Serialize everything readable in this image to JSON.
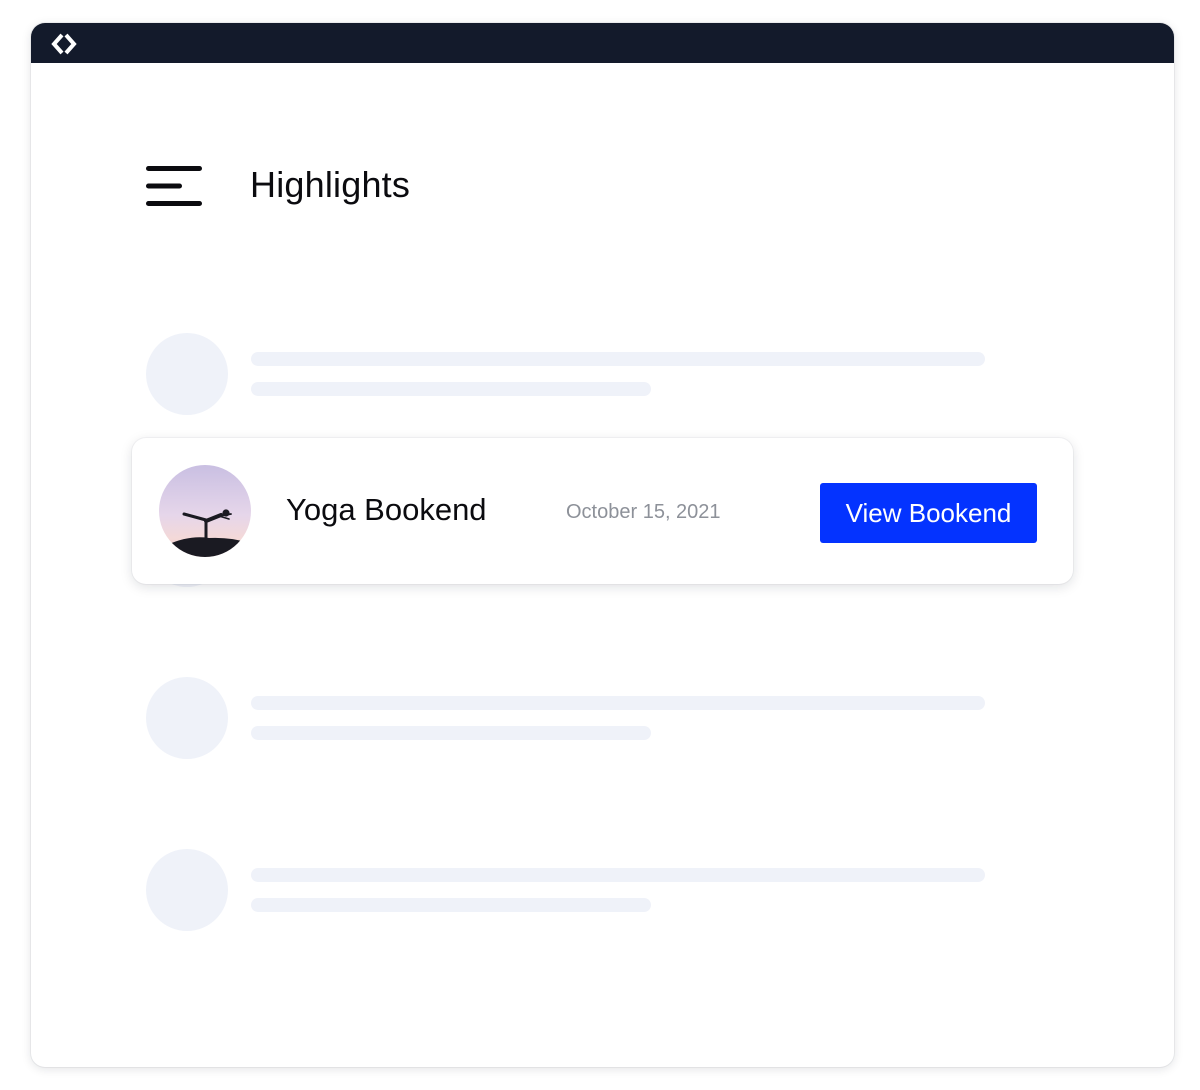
{
  "app": {
    "logo_icon": "code-brackets-logo-icon",
    "titlebar_color": "#131a2b"
  },
  "header": {
    "menu_icon": "hamburger-menu-icon",
    "title": "Highlights"
  },
  "highlight_card": {
    "title": "Yoga Bookend",
    "date": "October 15, 2021",
    "button_label": "View Bookend",
    "button_color": "#0433ff",
    "thumbnail": "yoga-silhouette-thumbnail"
  },
  "colors": {
    "skeleton": "#eff2f9",
    "date_text": "#8d9199",
    "title_text": "#0b0b0f"
  }
}
